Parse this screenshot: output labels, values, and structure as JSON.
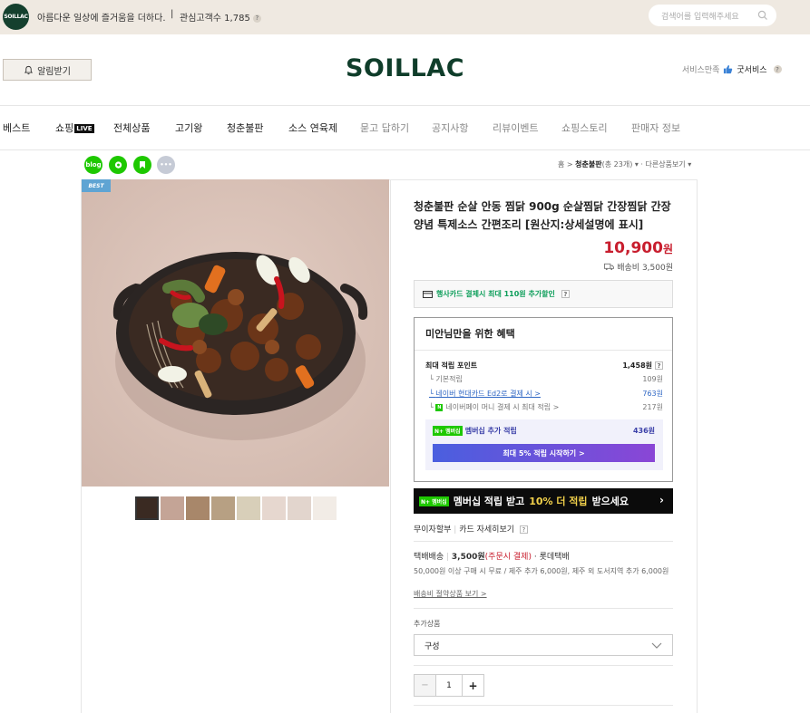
{
  "topbar": {
    "logo_text": "SOILLAC",
    "slogan": "아름다운 일상에 즐거움을 더하다.",
    "separator": "|",
    "fans": "관심고객수 1,785",
    "help": "?",
    "search_placeholder": "검색어를 입력해주세요"
  },
  "header": {
    "alarm_label": "알림받기",
    "brand": "SOILLAC",
    "service_label": "서비스만족",
    "good_service": "굿서비스",
    "help": "?"
  },
  "nav": {
    "items": [
      "베스트",
      "쇼핑",
      "전체상품",
      "고기왕",
      "청춘불판",
      "소스 연육제",
      "묻고 답하기",
      "공지사항",
      "리뷰이벤트",
      "쇼핑스토리",
      "판매자 정보"
    ],
    "live_badge": "LIVE"
  },
  "share": {
    "blog": "blog",
    "more": "•••"
  },
  "breadcrumb": {
    "home": "홈",
    "arrow": ">",
    "current": "청춘불판",
    "count": "(총 23개)",
    "more": "다른상품보기"
  },
  "product": {
    "badge": "BEST",
    "title": "청춘불판 순살 안동 찜닭 900g 순살찜닭 간장찜닭 간장양념 특제소스 간편조리 [원산지:상세설명에 표시]",
    "price": "10,900",
    "currency": "원",
    "shipping": "배송비 3,500원",
    "card_promo": "행사카드 결제시 최대 110원 추가할인",
    "help": "?"
  },
  "benefit": {
    "heading": "미안님만을 위한 혜택",
    "max_point_label": "최대 적립 포인트",
    "max_point_value": "1,458원",
    "help": "?",
    "rows": [
      {
        "label": "기본적립",
        "value": "109원"
      },
      {
        "label": "네이버 현대카드 Ed2로 결제 시 >",
        "value": "763원"
      },
      {
        "label": "네이버페이 머니 결제 시 최대 적립 >",
        "value": "217원"
      }
    ],
    "npay_badge": "N",
    "membership_badge": "N+ 멤버십",
    "membership_label": "멤버십 추가 적립",
    "membership_value": "436원",
    "membership_button": "최대 5% 적립 시작하기 >"
  },
  "banner": {
    "badge": "N+ 멤버십",
    "text_a": "멤버십 적립 받고",
    "text_hl": "10% 더 적립",
    "text_b": "받으세요",
    "arrow": "›"
  },
  "installment": {
    "label": "무이자할부",
    "sep": "|",
    "card_detail": "카드 자세히보기",
    "help": "?"
  },
  "delivery": {
    "label": "택배배송",
    "sep": "|",
    "fee": "3,500원",
    "fee_note": "(주문시 결제)",
    "courier": "· 롯데택배",
    "condition": "50,000원 이상 구매 시 무료 / 제주 추가 6,000원, 제주 외 도서지역 추가 6,000원",
    "save_link": "배송비 절약상품 보기 >"
  },
  "options": {
    "label": "추가상품",
    "select_value": "구성"
  },
  "quantity": {
    "minus": "−",
    "value": "1",
    "plus": "+"
  },
  "colors": {
    "brand_green": "#0f3d2a",
    "price_red": "#c81e2e",
    "naver_green": "#1ec800",
    "membership_purple": "#4a5fdf"
  },
  "icons": [
    "bell-icon",
    "search-icon",
    "thumbs-up-icon",
    "card-icon",
    "truck-icon",
    "chevron-down-icon",
    "blog-icon",
    "kakaostory-icon",
    "bookmark-icon",
    "more-icon"
  ]
}
